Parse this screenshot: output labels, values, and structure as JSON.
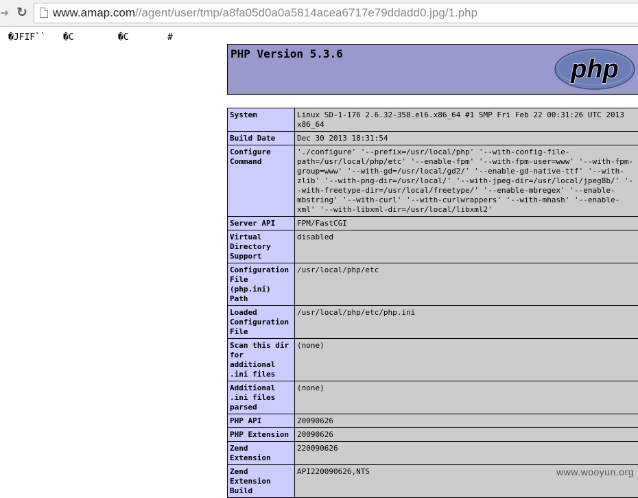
{
  "browser": {
    "forward_icon": "arrow-right-icon",
    "reload_icon": "reload-icon",
    "url_host": "www.amap.com",
    "url_path": "//agent/user/tmp/a8fa05d0a0a5814acea6717e79ddadd0.jpg/1.php"
  },
  "garbage": [
    "�JFIF``",
    "�C",
    "�C",
    "#"
  ],
  "phpinfo": {
    "version_title": "PHP Version 5.3.6",
    "logo_text": "php",
    "colors": {
      "header_bg": "#9999cc",
      "key_bg": "#ccccff",
      "value_bg": "#cccccc",
      "logo_bg": "#6c7eb7"
    },
    "rows": [
      {
        "key": "System",
        "value": "Linux SD-1-176 2.6.32-358.el6.x86_64 #1 SMP Fri Feb 22 00:31:26 UTC 2013 x86_64"
      },
      {
        "key": "Build Date",
        "value": "Dec 30 2013 18:31:54"
      },
      {
        "key": "Configure Command",
        "value": "'./configure' '--prefix=/usr/local/php' '--with-config-file-path=/usr/local/php/etc' '--enable-fpm' '--with-fpm-user=www' '--with-fpm-group=www' '--with-gd=/usr/local/gd2/' '--enable-gd-native-ttf' '--with-zlib' '--with-png-dir=/usr/local/' '--with-jpeg-dir=/usr/local/jpeg8b/' '--with-freetype-dir=/usr/local/freetype/' '--enable-mbregex' '--enable-mbstring' '--with-curl' '--with-curlwrappers' '--with-mhash' '--enable-xml' '--with-libxml-dir=/usr/local/libxml2'"
      },
      {
        "key": "Server API",
        "value": "FPM/FastCGI"
      },
      {
        "key": "Virtual Directory Support",
        "value": "disabled"
      },
      {
        "key": "Configuration File (php.ini) Path",
        "value": "/usr/local/php/etc"
      },
      {
        "key": "Loaded Configuration File",
        "value": "/usr/local/php/etc/php.ini"
      },
      {
        "key": "Scan this dir for additional .ini files",
        "value": "(none)"
      },
      {
        "key": "Additional .ini files parsed",
        "value": "(none)"
      },
      {
        "key": "PHP API",
        "value": "20090626"
      },
      {
        "key": "PHP Extension",
        "value": "20090626"
      },
      {
        "key": "Zend Extension",
        "value": "220090626"
      },
      {
        "key": "Zend Extension Build",
        "value": "API220090626,NTS"
      }
    ]
  },
  "watermark": "www.wooyun.org"
}
